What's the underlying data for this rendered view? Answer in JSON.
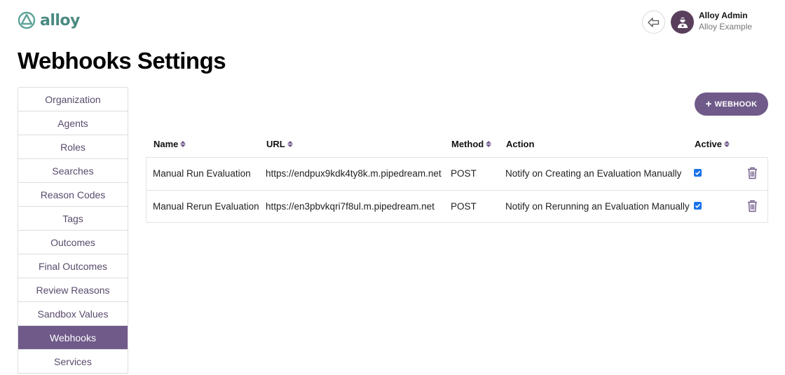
{
  "brand": {
    "name": "alloy",
    "accent": "#6f5a8a",
    "logo_color": "#4a8a82"
  },
  "header": {
    "back_icon": "back-arrow-icon",
    "user": {
      "name": "Alloy Admin",
      "org": "Alloy Example",
      "avatar_icon": "user-avatar-icon"
    }
  },
  "page": {
    "title": "Webhooks Settings"
  },
  "sidebar": {
    "items": [
      {
        "label": "Organization"
      },
      {
        "label": "Agents"
      },
      {
        "label": "Roles"
      },
      {
        "label": "Searches"
      },
      {
        "label": "Reason Codes"
      },
      {
        "label": "Tags"
      },
      {
        "label": "Outcomes"
      },
      {
        "label": "Final Outcomes"
      },
      {
        "label": "Review Reasons"
      },
      {
        "label": "Sandbox Values"
      },
      {
        "label": "Webhooks",
        "active": true
      },
      {
        "label": "Services"
      }
    ]
  },
  "toolbar": {
    "add_label": "WEBHOOK",
    "add_icon": "plus-icon"
  },
  "table": {
    "columns": {
      "name": "Name",
      "url": "URL",
      "method": "Method",
      "action": "Action",
      "active": "Active"
    },
    "rows": [
      {
        "name": "Manual Run Evaluation",
        "url": "https://endpux9kdk4ty8k.m.pipedream.net",
        "method": "POST",
        "action": "Notify on Creating an Evaluation Manually",
        "active": true
      },
      {
        "name": "Manual Rerun Evaluation",
        "url": "https://en3pbvkqri7f8ul.m.pipedream.net",
        "method": "POST",
        "action": "Notify on Rerunning an Evaluation Manually",
        "active": true
      }
    ]
  }
}
